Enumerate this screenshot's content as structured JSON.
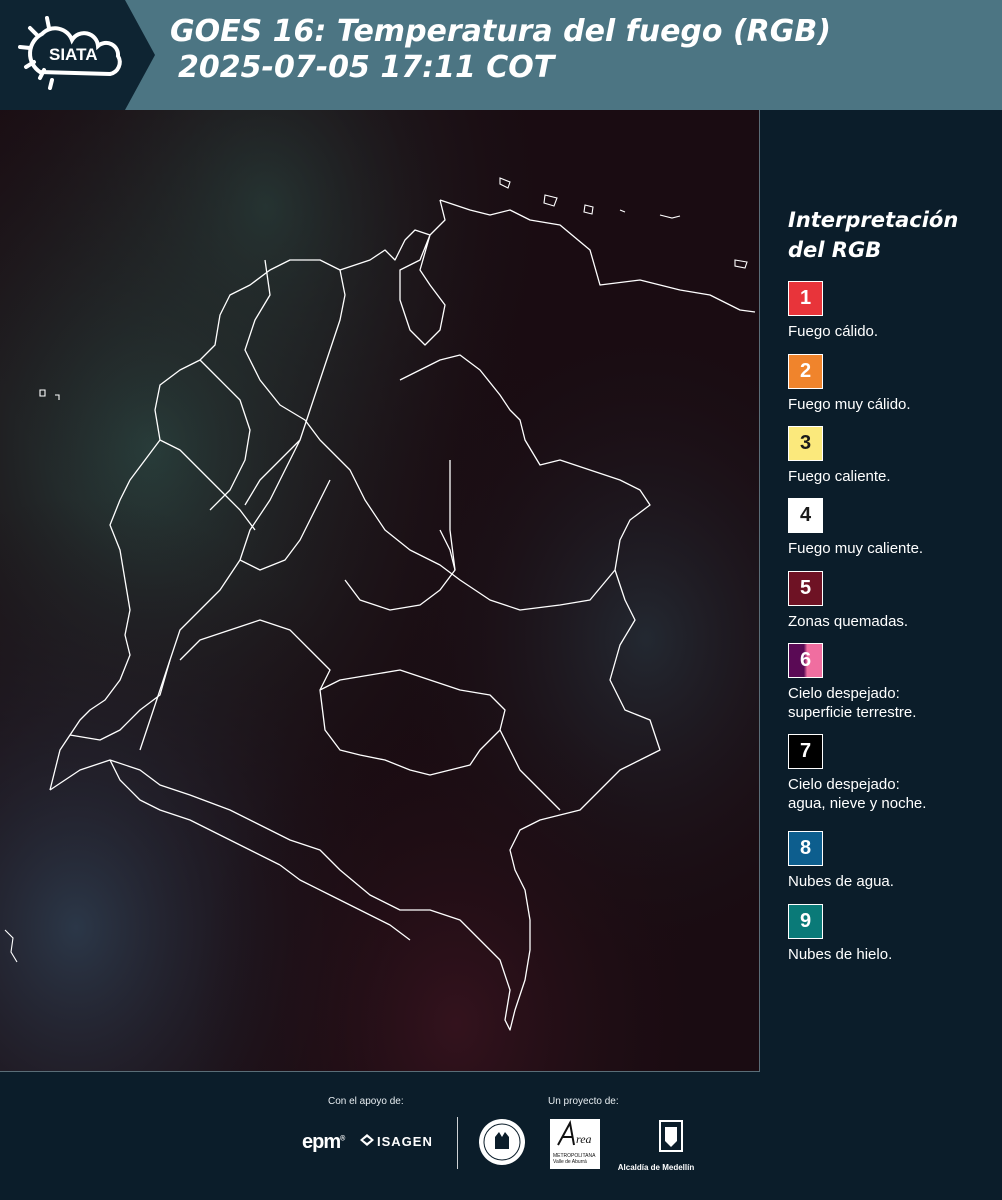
{
  "header": {
    "logo_text": "SIATA",
    "title_line1": "GOES 16: Temperatura del fuego (RGB)",
    "title_line2": "2025-07-05 17:11 COT",
    "logo_icon": "sun-cloud-icon"
  },
  "map": {
    "description_icon": "satellite-map-colombia",
    "background_color": "#1a0c12"
  },
  "legend": {
    "title_line1": "Interpretación",
    "title_line2": "del RGB",
    "items": [
      {
        "number": "1",
        "label": "Fuego cálido.",
        "color": "#e8343a"
      },
      {
        "number": "2",
        "label": "Fuego muy cálido.",
        "color": "#f0842c"
      },
      {
        "number": "3",
        "label": "Fuego caliente.",
        "color": "#fbe97c"
      },
      {
        "number": "4",
        "label": "Fuego muy caliente.",
        "color": "#ffffff"
      },
      {
        "number": "5",
        "label": "Zonas quemadas.",
        "color": "#6e1224"
      },
      {
        "number": "6",
        "label_line1": "Cielo despejado:",
        "label_line2": "superficie terrestre.",
        "color": "#5a0a55",
        "color2": "#f06ea0"
      },
      {
        "number": "7",
        "label_line1": "Cielo despejado:",
        "label_line2": "agua, nieve y noche.",
        "color": "#000000"
      },
      {
        "number": "8",
        "label": "Nubes de agua.",
        "color": "#0d5e8e"
      },
      {
        "number": "9",
        "label": "Nubes de hielo.",
        "color": "#0a7a78"
      }
    ]
  },
  "footer": {
    "support_label": "Con el apoyo de:",
    "project_label": "Un proyecto de:",
    "epm": "epm",
    "isagen": "ISAGEN",
    "area_text_1": "METROPOLITANA",
    "area_text_2": "Valle de Aburrá",
    "alcaldia": "Alcaldía de Medellín"
  }
}
